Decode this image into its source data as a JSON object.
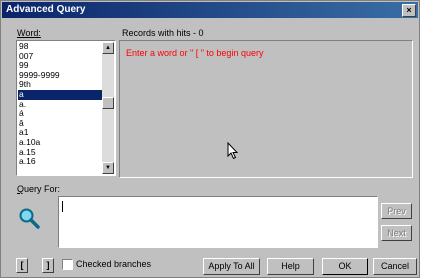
{
  "window": {
    "title": "Advanced Query",
    "close_glyph": "×"
  },
  "word_label": "Word:",
  "records_label": "Records with hits - 0",
  "words": [
    "98",
    "007",
    "99",
    "9999-9999",
    "9th",
    "a",
    "a.",
    "á",
    "â",
    "a1",
    "a.10a",
    "a.15",
    "a.16"
  ],
  "selected_word_index": 5,
  "records_message": "Enter a word or \" [ \" to begin query",
  "query_label": "Query For:",
  "query_value": "",
  "buttons": {
    "prev": "Prev",
    "next": "Next",
    "bracket_open": "[",
    "bracket_close": "]",
    "apply_to_all": "Apply To All",
    "help": "Help",
    "ok": "OK",
    "cancel": "Cancel"
  },
  "checked_branches_label": "Checked branches",
  "checked_branches": false,
  "icons": {
    "scroll_up": "scroll-up-icon",
    "scroll_down": "scroll-down-icon",
    "query": "magnifier-icon",
    "pointer": "mouse-pointer-icon"
  }
}
